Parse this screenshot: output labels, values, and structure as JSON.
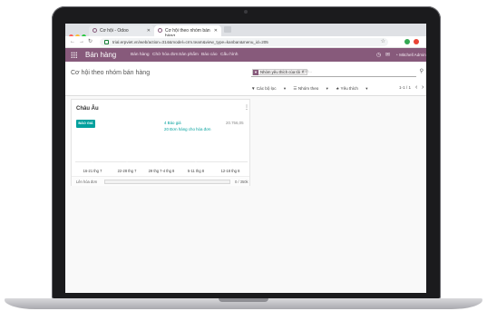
{
  "browser": {
    "tabs": [
      {
        "label": "Cơ hội - Odoo",
        "active": false
      },
      {
        "label": "Cơ hội theo nhóm bán hàng",
        "active": true
      }
    ],
    "url": "trial.erpviet.vn/web/action=314&model=crm.team&view_type=kanban&menu_id=205"
  },
  "topbar": {
    "brand": "Bán hàng",
    "menu": [
      "Bán hàng",
      "Chờ hóa đơn",
      "Sản phẩm",
      "Báo cáo",
      "Cấu hình"
    ],
    "user": "Mitchell Admin",
    "color": "#875a7b"
  },
  "control": {
    "title": "Cơ hội theo nhóm bán hàng",
    "facet": "Nhóm yêu thích của tôi",
    "search_placeholder": "Tìm...",
    "filters": [
      "Các bộ lọc",
      "Nhóm theo",
      "Yêu thích"
    ],
    "pager": "1-1 / 1"
  },
  "card": {
    "name": "Châu Âu",
    "quote_button": "BÁO GIÁ",
    "quotes_link": "4 Báo giá",
    "orders_link": "20 Đơn hàng cho hóa đơn",
    "amount": "20.756,05",
    "chart_data": {
      "type": "bar",
      "categories": [
        "16-21 thg 7",
        "22-28 thg 7",
        "29 thg 7-4 thg 8",
        "5-11 thg 8",
        "12-18 thg 8"
      ],
      "values": [
        0,
        0,
        0,
        0,
        0
      ]
    },
    "invoice_label": "Lên hóa đơn",
    "invoice_progress": 0,
    "invoice_value": "0 / 350k",
    "accent": "#00a09d"
  }
}
